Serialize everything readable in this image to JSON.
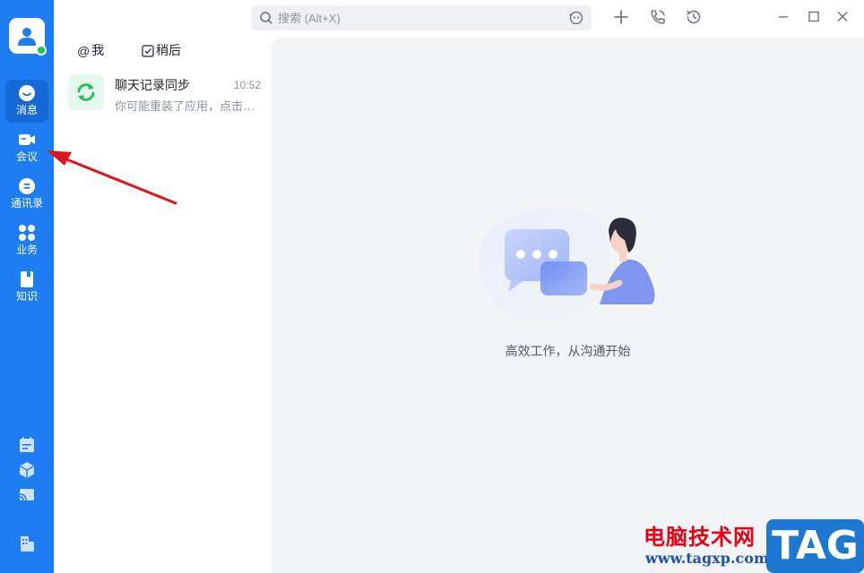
{
  "rail": {
    "items": [
      {
        "label": "消息",
        "icon": "message-icon"
      },
      {
        "label": "会议",
        "icon": "video-meeting-icon"
      },
      {
        "label": "通讯录",
        "icon": "contacts-icon"
      },
      {
        "label": "业务",
        "icon": "apps-grid-icon"
      },
      {
        "label": "知识",
        "icon": "knowledge-book-icon"
      }
    ],
    "bottom_icons": [
      "calendar-icon",
      "cube-icon",
      "cast-icon",
      "building-icon"
    ]
  },
  "middle": {
    "tabs": [
      {
        "label": "我",
        "icon": "at-icon"
      },
      {
        "label": "稍后",
        "icon": "checkbox-icon"
      }
    ],
    "conversations": [
      {
        "title": "聊天记录同步",
        "time": "10:52",
        "preview": "你可能重装了应用，点击同步聊天记录",
        "icon": "sync-icon"
      }
    ]
  },
  "titlebar": {
    "search_placeholder": "搜索 (Alt+X)"
  },
  "main": {
    "empty_text": "高效工作，从沟通开始"
  },
  "watermark": {
    "site_name": "电脑技术网",
    "url": "www.tagxp.com",
    "badge": "TAG"
  },
  "colors": {
    "rail": "#1e7df2",
    "rail_active": "#1569d6",
    "main_bg": "#f3f4f6",
    "arrow": "#e0161d"
  }
}
